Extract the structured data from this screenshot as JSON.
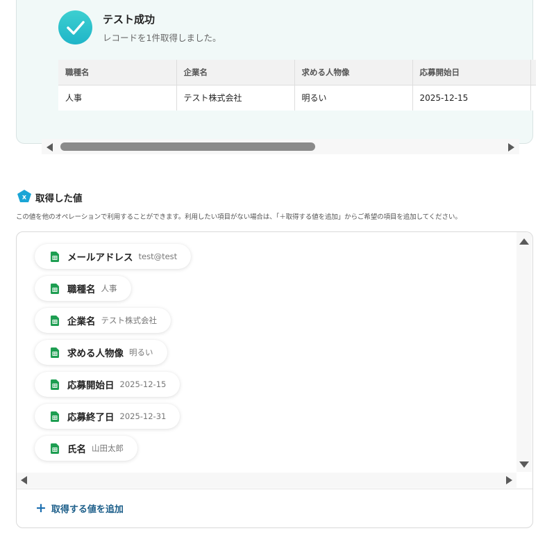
{
  "success": {
    "title": "テスト成功",
    "subtitle": "レコードを1件取得しました。"
  },
  "table": {
    "headers": [
      "職種名",
      "企業名",
      "求める人物像",
      "応募開始日"
    ],
    "rows": [
      [
        "人事",
        "テスト株式会社",
        "明るい",
        "2025-12-15"
      ]
    ]
  },
  "values_section": {
    "title": "取得した値",
    "description": "この値を他のオペレーションで利用することができます。利用したい項目がない場合は、「＋取得する値を追加」からご希望の項目を追加してください。",
    "items": [
      {
        "label": "メールアドレス",
        "value": "test@test"
      },
      {
        "label": "職種名",
        "value": "人事"
      },
      {
        "label": "企業名",
        "value": "テスト株式会社"
      },
      {
        "label": "求める人物像",
        "value": "明るい"
      },
      {
        "label": "応募開始日",
        "value": "2025-12-15"
      },
      {
        "label": "応募終了日",
        "value": "2025-12-31"
      },
      {
        "label": "氏名",
        "value": "山田太郎"
      }
    ],
    "add_button": "取得する値を追加"
  },
  "icons": {
    "success": "check-icon",
    "section": "yoom-logo-icon",
    "item": "google-sheets-icon",
    "add": "plus-icon"
  },
  "colors": {
    "accent_teal": "#27c0cc",
    "card_bg": "#f1f9f8",
    "sheets_green": "#1e9e52",
    "link_blue": "#1d5f8a"
  }
}
